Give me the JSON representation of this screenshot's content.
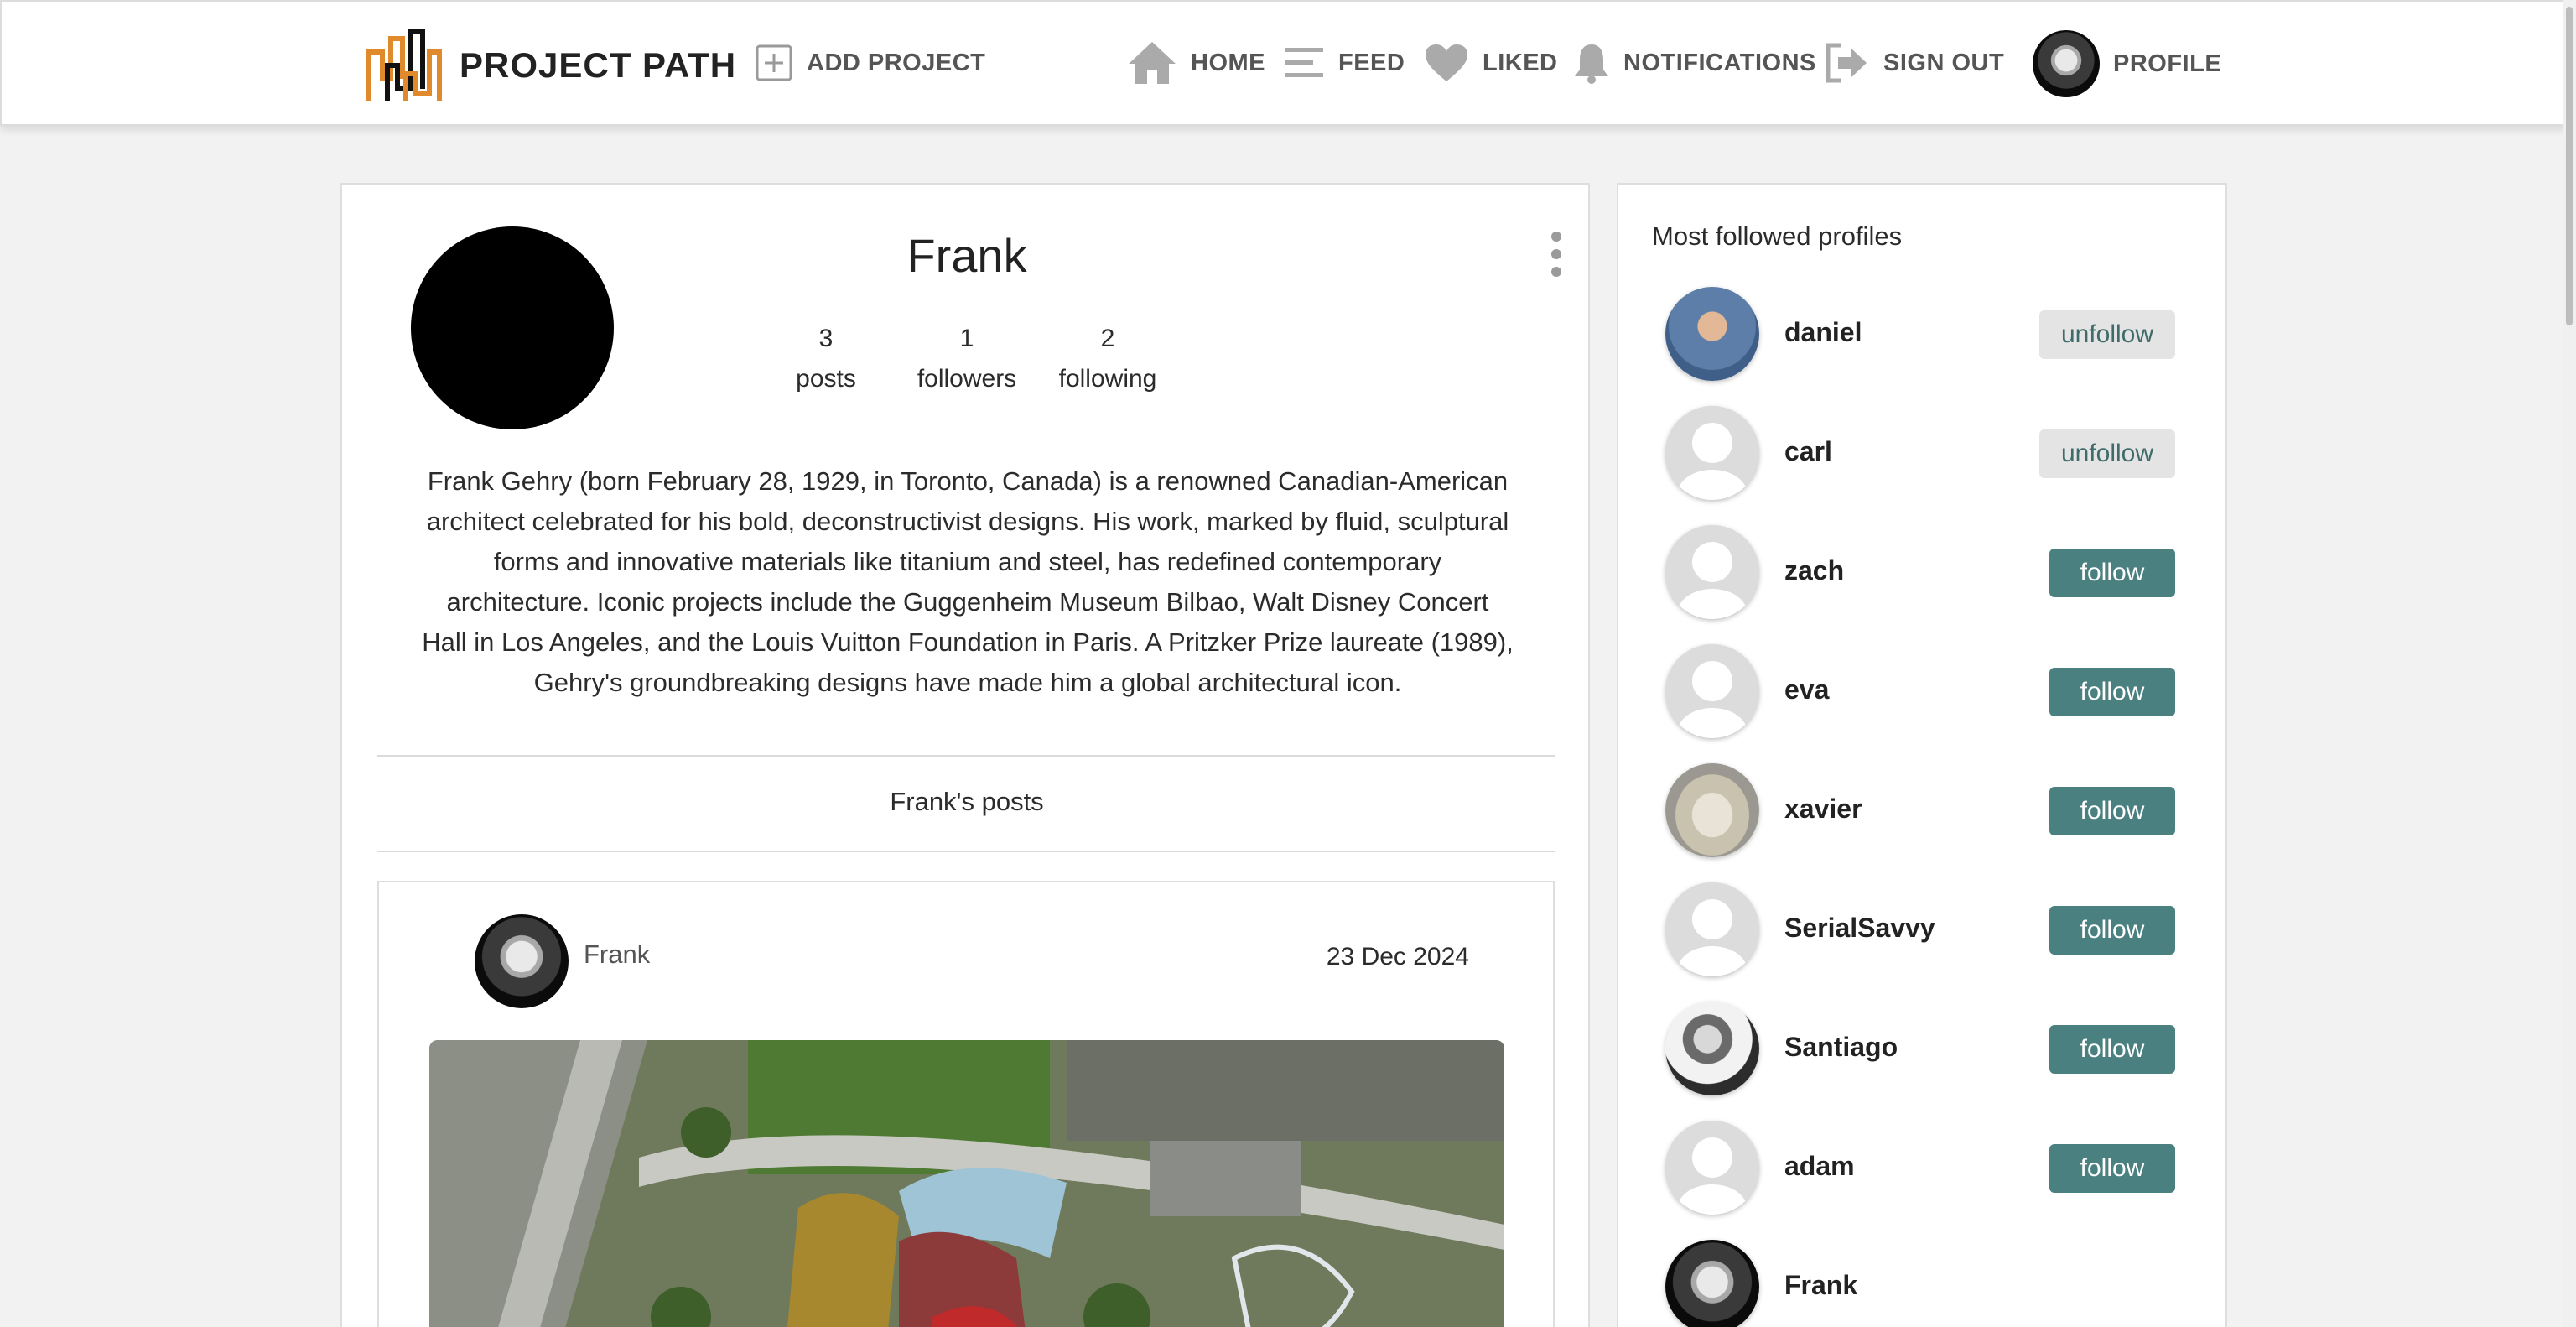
{
  "app": {
    "brand_name": "PROJECT PATH",
    "accent_color": "#4a8180",
    "logo_colors": [
      "#e08a2c",
      "#111111"
    ]
  },
  "nav": {
    "add_project": {
      "label": "ADD PROJECT",
      "icon": "plus-square-icon"
    },
    "home": {
      "label": "HOME",
      "icon": "home-icon"
    },
    "feed": {
      "label": "FEED",
      "icon": "feed-lines-icon"
    },
    "liked": {
      "label": "LIKED",
      "icon": "heart-icon"
    },
    "notifications": {
      "label": "NOTIFICATIONS",
      "icon": "bell-icon"
    },
    "sign_out": {
      "label": "SIGN OUT",
      "icon": "sign-out-icon"
    },
    "profile": {
      "label": "PROFILE",
      "icon": "avatar"
    }
  },
  "profile": {
    "name": "Frank",
    "stats": [
      {
        "value": "3",
        "label": "posts"
      },
      {
        "value": "1",
        "label": "followers"
      },
      {
        "value": "2",
        "label": "following"
      }
    ],
    "bio": "Frank Gehry (born February 28, 1929, in Toronto, Canada) is a renowned Canadian-American architect celebrated for his bold, deconstructivist designs. His work, marked by fluid, sculptural forms and innovative materials like titanium and steel, has redefined contemporary architecture. Iconic projects include the Guggenheim Museum Bilbao, Walt Disney Concert Hall in Los Angeles, and the Louis Vuitton Foundation in Paris. A Pritzker Prize laureate (1989), Gehry's groundbreaking designs have made him a global architectural icon.",
    "posts_heading": "Frank's posts"
  },
  "post": {
    "author": "Frank",
    "date": "23 Dec 2024"
  },
  "sidebar": {
    "title": "Most followed profiles",
    "profiles": [
      {
        "name": "daniel",
        "action": "unfollow"
      },
      {
        "name": "carl",
        "action": "unfollow"
      },
      {
        "name": "zach",
        "action": "follow"
      },
      {
        "name": "eva",
        "action": "follow"
      },
      {
        "name": "xavier",
        "action": "follow"
      },
      {
        "name": "SerialSavvy",
        "action": "follow"
      },
      {
        "name": "Santiago",
        "action": "follow"
      },
      {
        "name": "adam",
        "action": "follow"
      },
      {
        "name": "Frank",
        "action": ""
      }
    ]
  }
}
